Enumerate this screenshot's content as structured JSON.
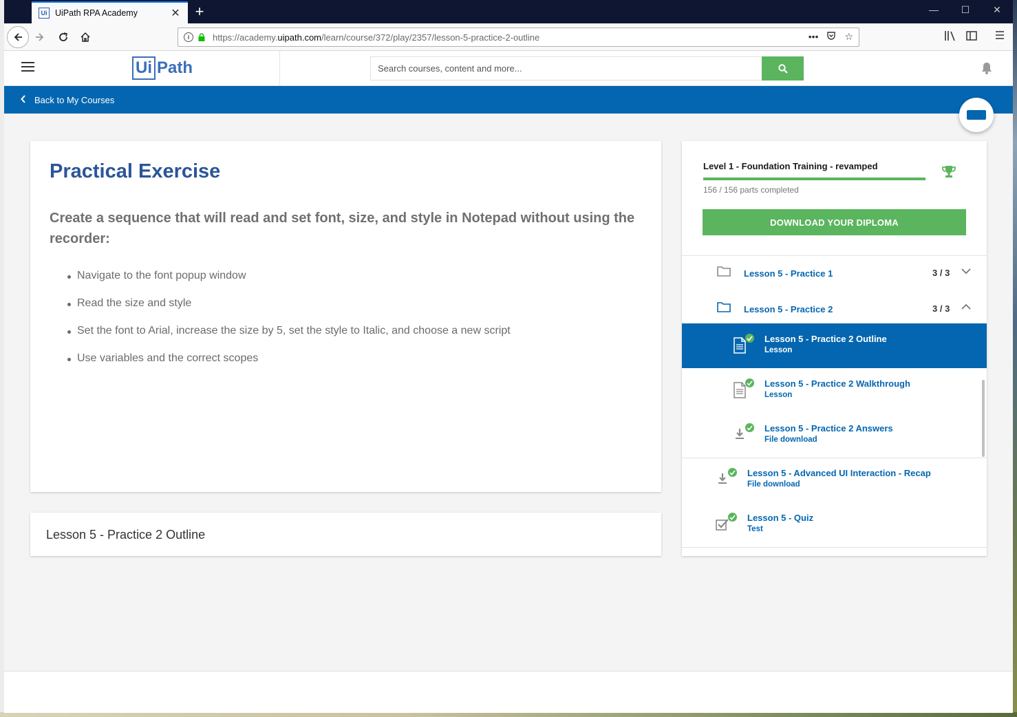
{
  "browser": {
    "tab_title": "UiPath RPA Academy",
    "tab_favicon": "Ui",
    "new_tab": "+",
    "url_prefix": "https://academy.",
    "url_domain": "uipath.com",
    "url_path": "/learn/course/372/play/2357/lesson-5-practice-2-outline"
  },
  "site": {
    "logo_ui": "Ui",
    "logo_path": "Path",
    "search_placeholder": "Search courses, content and more...",
    "back_label": "Back to My Courses"
  },
  "exercise": {
    "title": "Practical Exercise",
    "subtitle": "Create a sequence that will read and set font, size, and style in Notepad without using the recorder:",
    "items": [
      "Navigate to the font popup window",
      "Read the size and style",
      "Set the font to Arial, increase the size by 5, set the style to Italic, and choose a new script",
      "Use variables and the correct scopes"
    ]
  },
  "lesson_title": "Lesson 5 - Practice 2 Outline",
  "sidebar": {
    "course_name": "Level 1 - Foundation Training - revamped",
    "progress_fraction": 1.0,
    "parts_completed": "156 / 156 parts completed",
    "diploma_button": "DOWNLOAD YOUR DIPLOMA",
    "folders": [
      {
        "label": "Lesson 5 - Practice 1",
        "count": "3 / 3",
        "expanded": false
      },
      {
        "label": "Lesson 5 - Practice 2",
        "count": "3 / 3",
        "expanded": true
      }
    ],
    "items": [
      {
        "title": "Lesson 5 - Practice 2 Outline",
        "type": "Lesson",
        "icon": "document-icon",
        "active": true
      },
      {
        "title": "Lesson 5 - Practice 2 Walkthrough",
        "type": "Lesson",
        "icon": "document-icon",
        "active": false
      },
      {
        "title": "Lesson 5 - Practice 2 Answers",
        "type": "File download",
        "icon": "download-icon",
        "active": false
      },
      {
        "title": "Lesson 5 - Advanced UI Interaction - Recap",
        "type": "File download",
        "icon": "download-icon",
        "active": false
      },
      {
        "title": "Lesson 5 - Quiz",
        "type": "Test",
        "icon": "quiz-check-icon",
        "active": false
      }
    ]
  },
  "colors": {
    "brand_blue": "#0466b0",
    "success_green": "#5ab55e",
    "title_blue": "#2b5597"
  }
}
